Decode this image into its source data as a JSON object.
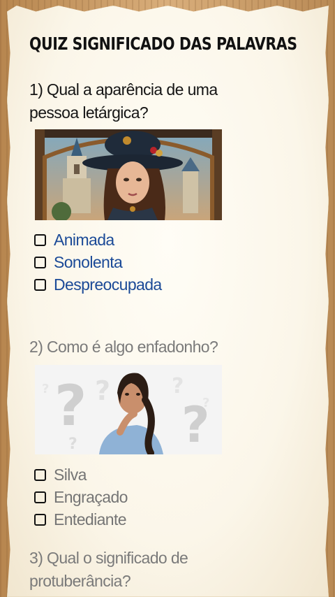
{
  "title": "QUIZ SIGNIFICADO DAS PALAVRAS",
  "questions": [
    {
      "line1": "1) Qual a aparência de uma",
      "line2": "pessoa letárgica?",
      "options": [
        "Animada",
        "Sonolenta",
        "Despreocupada"
      ]
    },
    {
      "line1": "2) Como é algo enfadonho?",
      "options": [
        "Silva",
        "Engraçado",
        "Entediante"
      ]
    },
    {
      "line1": "3) Qual o significado de",
      "line2": "protuberância?"
    }
  ],
  "colors": {
    "option_active": "#1b4a97",
    "option_dim": "#757575",
    "paper": "#fbf6e9",
    "wood": "#c99a68"
  }
}
